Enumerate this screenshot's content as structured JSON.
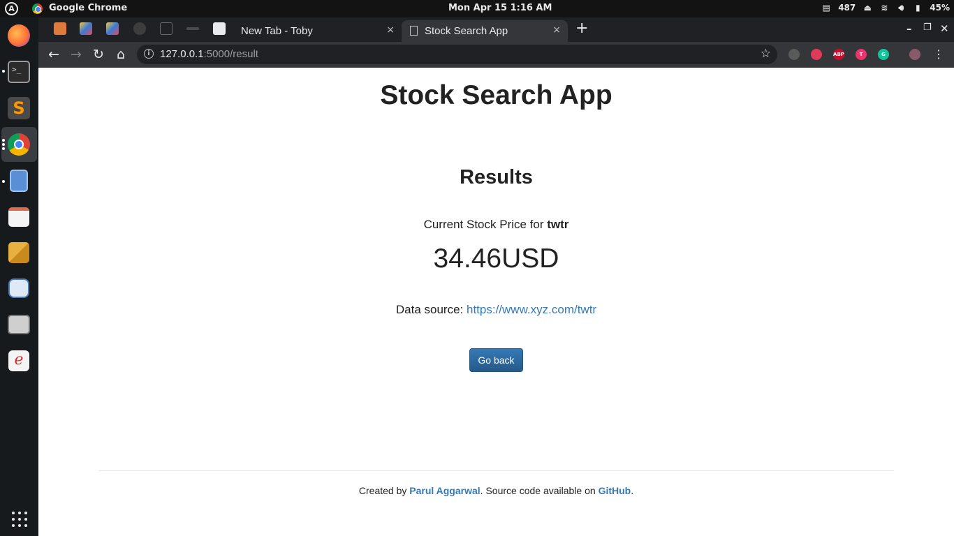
{
  "system_panel": {
    "app_name": "Google Chrome",
    "clock": "Mon Apr 15   1:16 AM",
    "counter": "487",
    "battery": "45%"
  },
  "browser": {
    "tabs": [
      {
        "title": "New Tab - Toby",
        "close": "×"
      },
      {
        "title": "Stock Search App",
        "close": "×"
      }
    ],
    "new_tab_label": "+",
    "window_controls": {
      "minimize": "–",
      "maximize": "❐",
      "close": "✕"
    },
    "address": {
      "host": "127.0.0.1",
      "path": ":5000/result"
    },
    "extensions": [
      {
        "name": "privacy-badger-icon",
        "label": "",
        "color": "#5a5a5a"
      },
      {
        "name": "brave-shield-icon",
        "label": "",
        "color": "#e0395a"
      },
      {
        "name": "adblock-plus-icon",
        "label": "ABP",
        "color": "#c70d2c"
      },
      {
        "name": "toby-extension-icon",
        "label": "T",
        "color": "#e8356d"
      },
      {
        "name": "grammarly-icon",
        "label": "G",
        "color": "#15c39a"
      }
    ]
  },
  "page": {
    "app_title": "Stock Search App",
    "results_heading": "Results",
    "price_label_prefix": "Current Stock Price for ",
    "ticker": "twtr",
    "price_value": "34.46USD",
    "source_label": "Data source: ",
    "source_url": "https://www.xyz.com/twtr",
    "go_back_label": "Go back",
    "footer": {
      "created_by": "Created by ",
      "author": "Parul Aggarwal",
      "middle": ". Source code available on ",
      "github": "GitHub",
      "end": "."
    }
  },
  "colors": {
    "link": "#337ab7",
    "button": "#286090",
    "chrome_dark": "#202124",
    "chrome_toolbar": "#35363a"
  }
}
